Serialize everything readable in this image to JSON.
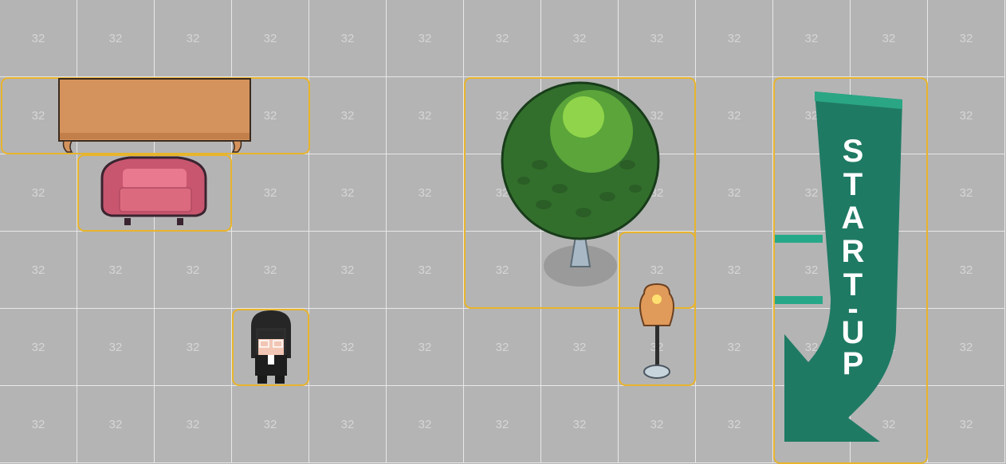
{
  "grid": {
    "columns": 13,
    "rows": 6,
    "tile_label": "32",
    "background_color": "#b4b4b4",
    "line_color": "#e8e8e8"
  },
  "selection_color": "#e8b42c",
  "objects": [
    {
      "name": "table",
      "sprite": "wooden-table"
    },
    {
      "name": "sofa",
      "sprite": "pink-sofa"
    },
    {
      "name": "character",
      "sprite": "dark-haired-character-with-glasses"
    },
    {
      "name": "tree",
      "sprite": "round-green-tree"
    },
    {
      "name": "lamp",
      "sprite": "floor-lamp"
    },
    {
      "name": "startup-sign",
      "sprite": "arrow-sign"
    }
  ],
  "sign": {
    "letters": [
      "S",
      "T",
      "A",
      "R",
      "T",
      "-",
      "U",
      "P"
    ],
    "color": "#1f7a64"
  }
}
